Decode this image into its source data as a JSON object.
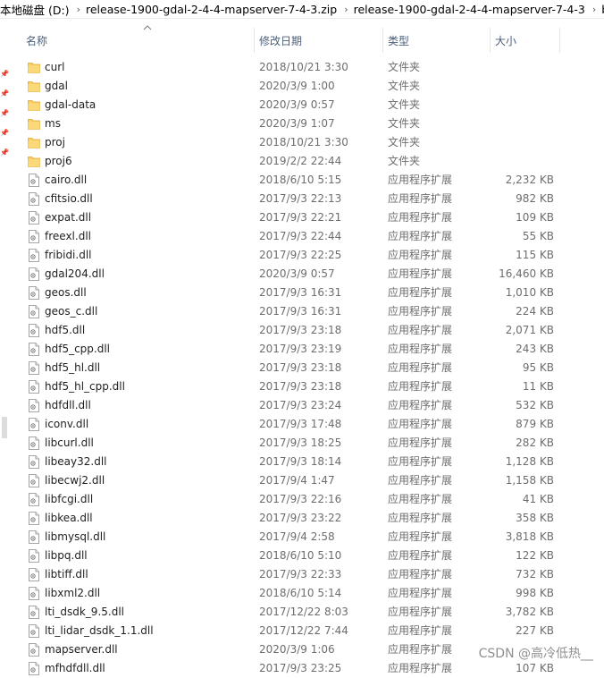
{
  "breadcrumb": [
    "本地磁盘 (D:)",
    "release-1900-gdal-2-4-4-mapserver-7-4-3.zip",
    "release-1900-gdal-2-4-4-mapserver-7-4-3",
    "bin"
  ],
  "columns": {
    "name": "名称",
    "date": "修改日期",
    "type": "类型",
    "size": "大小"
  },
  "rows": [
    {
      "name": "curl",
      "date": "2018/10/21 3:30",
      "type": "文件夹",
      "size": "",
      "icon": "folder-icon"
    },
    {
      "name": "gdal",
      "date": "2020/3/9 1:00",
      "type": "文件夹",
      "size": "",
      "icon": "folder-icon"
    },
    {
      "name": "gdal-data",
      "date": "2020/3/9 0:57",
      "type": "文件夹",
      "size": "",
      "icon": "folder-icon"
    },
    {
      "name": "ms",
      "date": "2020/3/9 1:07",
      "type": "文件夹",
      "size": "",
      "icon": "folder-icon"
    },
    {
      "name": "proj",
      "date": "2018/10/21 3:30",
      "type": "文件夹",
      "size": "",
      "icon": "folder-icon"
    },
    {
      "name": "proj6",
      "date": "2019/2/2 22:44",
      "type": "文件夹",
      "size": "",
      "icon": "folder-icon"
    },
    {
      "name": "cairo.dll",
      "date": "2018/6/10 5:15",
      "type": "应用程序扩展",
      "size": "2,232 KB",
      "icon": "dll-file-icon"
    },
    {
      "name": "cfitsio.dll",
      "date": "2017/9/3 22:13",
      "type": "应用程序扩展",
      "size": "982 KB",
      "icon": "dll-file-icon"
    },
    {
      "name": "expat.dll",
      "date": "2017/9/3 22:21",
      "type": "应用程序扩展",
      "size": "109 KB",
      "icon": "dll-file-icon"
    },
    {
      "name": "freexl.dll",
      "date": "2017/9/3 22:44",
      "type": "应用程序扩展",
      "size": "55 KB",
      "icon": "dll-file-icon"
    },
    {
      "name": "fribidi.dll",
      "date": "2017/9/3 22:25",
      "type": "应用程序扩展",
      "size": "115 KB",
      "icon": "dll-file-icon"
    },
    {
      "name": "gdal204.dll",
      "date": "2020/3/9 0:57",
      "type": "应用程序扩展",
      "size": "16,460 KB",
      "icon": "dll-file-icon"
    },
    {
      "name": "geos.dll",
      "date": "2017/9/3 16:31",
      "type": "应用程序扩展",
      "size": "1,010 KB",
      "icon": "dll-file-icon"
    },
    {
      "name": "geos_c.dll",
      "date": "2017/9/3 16:31",
      "type": "应用程序扩展",
      "size": "224 KB",
      "icon": "dll-file-icon"
    },
    {
      "name": "hdf5.dll",
      "date": "2017/9/3 23:18",
      "type": "应用程序扩展",
      "size": "2,071 KB",
      "icon": "dll-file-icon"
    },
    {
      "name": "hdf5_cpp.dll",
      "date": "2017/9/3 23:19",
      "type": "应用程序扩展",
      "size": "243 KB",
      "icon": "dll-file-icon"
    },
    {
      "name": "hdf5_hl.dll",
      "date": "2017/9/3 23:18",
      "type": "应用程序扩展",
      "size": "95 KB",
      "icon": "dll-file-icon"
    },
    {
      "name": "hdf5_hl_cpp.dll",
      "date": "2017/9/3 23:18",
      "type": "应用程序扩展",
      "size": "11 KB",
      "icon": "dll-file-icon"
    },
    {
      "name": "hdfdll.dll",
      "date": "2017/9/3 23:24",
      "type": "应用程序扩展",
      "size": "532 KB",
      "icon": "dll-file-icon"
    },
    {
      "name": "iconv.dll",
      "date": "2017/9/3 17:48",
      "type": "应用程序扩展",
      "size": "879 KB",
      "icon": "dll-file-icon"
    },
    {
      "name": "libcurl.dll",
      "date": "2017/9/3 18:25",
      "type": "应用程序扩展",
      "size": "282 KB",
      "icon": "dll-file-icon"
    },
    {
      "name": "libeay32.dll",
      "date": "2017/9/3 18:14",
      "type": "应用程序扩展",
      "size": "1,128 KB",
      "icon": "dll-file-icon"
    },
    {
      "name": "libecwj2.dll",
      "date": "2017/9/4 1:47",
      "type": "应用程序扩展",
      "size": "1,158 KB",
      "icon": "dll-file-icon"
    },
    {
      "name": "libfcgi.dll",
      "date": "2017/9/3 22:16",
      "type": "应用程序扩展",
      "size": "41 KB",
      "icon": "dll-file-icon"
    },
    {
      "name": "libkea.dll",
      "date": "2017/9/3 23:22",
      "type": "应用程序扩展",
      "size": "358 KB",
      "icon": "dll-file-icon"
    },
    {
      "name": "libmysql.dll",
      "date": "2017/9/4 2:58",
      "type": "应用程序扩展",
      "size": "3,818 KB",
      "icon": "dll-file-icon"
    },
    {
      "name": "libpq.dll",
      "date": "2018/6/10 5:10",
      "type": "应用程序扩展",
      "size": "122 KB",
      "icon": "dll-file-icon"
    },
    {
      "name": "libtiff.dll",
      "date": "2017/9/3 22:33",
      "type": "应用程序扩展",
      "size": "732 KB",
      "icon": "dll-file-icon"
    },
    {
      "name": "libxml2.dll",
      "date": "2018/6/10 5:14",
      "type": "应用程序扩展",
      "size": "998 KB",
      "icon": "dll-file-icon"
    },
    {
      "name": "lti_dsdk_9.5.dll",
      "date": "2017/12/22 8:03",
      "type": "应用程序扩展",
      "size": "3,782 KB",
      "icon": "dll-file-icon"
    },
    {
      "name": "lti_lidar_dsdk_1.1.dll",
      "date": "2017/12/22 7:44",
      "type": "应用程序扩展",
      "size": "227 KB",
      "icon": "dll-file-icon"
    },
    {
      "name": "mapserver.dll",
      "date": "2020/3/9 1:06",
      "type": "应用程序扩展",
      "size": "",
      "icon": "dll-file-icon"
    },
    {
      "name": "mfhdfdll.dll",
      "date": "2017/9/3 23:25",
      "type": "应用程序扩展",
      "size": "107 KB",
      "icon": "dll-file-icon"
    }
  ],
  "watermark": "CSDN @高冷低热__",
  "colors": {
    "folder": "#f5c451",
    "folder_dark": "#e2a627",
    "header_text": "#4c607a"
  }
}
